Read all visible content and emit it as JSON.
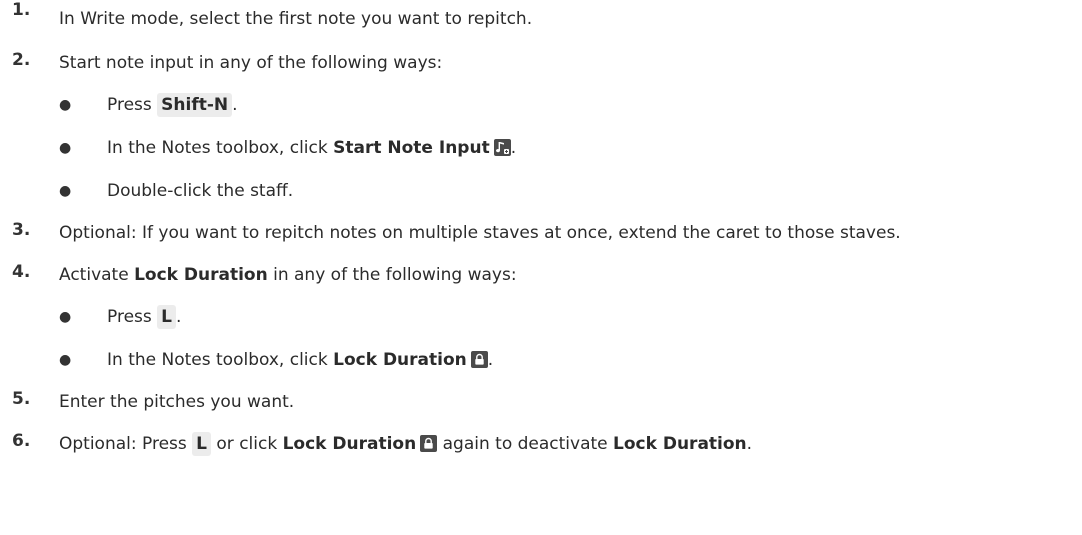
{
  "steps": [
    {
      "num": "1.",
      "text": "In Write mode, select the first note you want to repitch."
    },
    {
      "num": "2.",
      "text": "Start note input in any of the following ways:",
      "sub": [
        {
          "pre": "Press ",
          "key": "Shift-N",
          "post": "."
        },
        {
          "pre": "In the Notes toolbox, click ",
          "bold": "Start Note Input",
          "icon": "start-note-input-icon",
          "post": "."
        },
        {
          "text": "Double-click the staff."
        }
      ]
    },
    {
      "num": "3.",
      "text": "Optional: If you want to repitch notes on multiple staves at once, extend the caret to those staves."
    },
    {
      "num": "4.",
      "pre": "Activate ",
      "bold": "Lock Duration",
      "post": " in any of the following ways:",
      "sub": [
        {
          "pre": "Press ",
          "key": "L",
          "post": "."
        },
        {
          "pre": "In the Notes toolbox, click ",
          "bold": "Lock Duration",
          "icon": "lock-icon",
          "post": "."
        }
      ]
    },
    {
      "num": "5.",
      "text": "Enter the pitches you want."
    },
    {
      "num": "6.",
      "pre": "Optional: Press ",
      "key": "L",
      "mid": " or click ",
      "bold": "Lock Duration",
      "icon": "lock-icon",
      "post1": " again to deactivate ",
      "bold2": "Lock Duration",
      "post2": "."
    }
  ],
  "bullet_char": "●"
}
